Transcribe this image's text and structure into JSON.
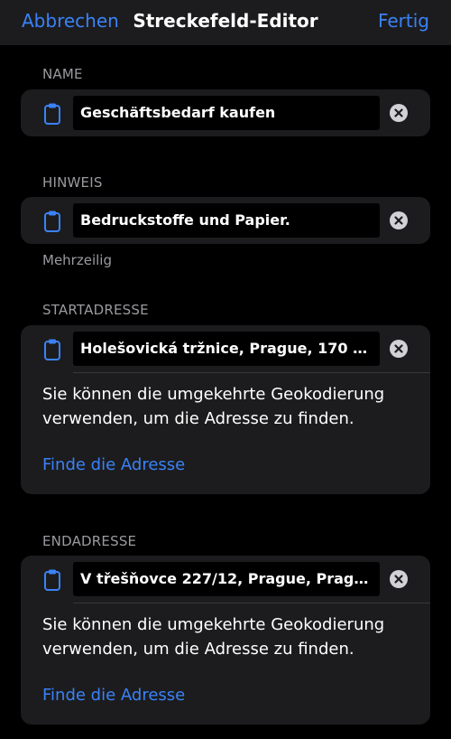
{
  "nav": {
    "cancel_label": "Abbrechen",
    "title": "Streckefeld-Editor",
    "done_label": "Fertig"
  },
  "name_section": {
    "header": "NAME",
    "value": "Geschäftsbedarf kaufen",
    "leading_icon": "clipboard-icon",
    "clear_icon": "clear-circle-icon"
  },
  "hint_section": {
    "header": "HINWEIS",
    "value": "Bedruckstoffe und Papier.",
    "footer": "Mehrzeilig",
    "leading_icon": "clipboard-icon",
    "clear_icon": "clear-circle-icon"
  },
  "start_section": {
    "header": "STARTADRESSE",
    "value": "Holešovická tržnice, Prague, 170 0...",
    "description": "Sie können die umgekehrte Geokodierung verwenden, um die Adresse zu finden.",
    "link": "Finde die Adresse",
    "leading_icon": "clipboard-icon",
    "clear_icon": "clear-circle-icon"
  },
  "end_section": {
    "header": "ENDADRESSE",
    "value": "V třešňovce 227/12, Prague, Pragu...",
    "description": "Sie können die umgekehrte Geokodierung verwenden, um die Adresse zu finden.",
    "link": "Finde die Adresse",
    "leading_icon": "clipboard-icon",
    "clear_icon": "clear-circle-icon"
  },
  "colors": {
    "accent": "#3a82f7",
    "background": "#000000",
    "card": "#1c1c1e",
    "secondary_text": "#9a9aa0"
  }
}
